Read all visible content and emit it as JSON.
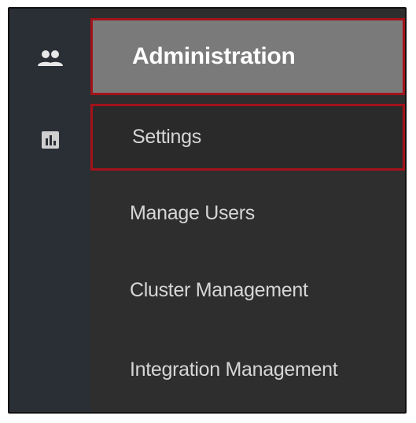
{
  "sidebar": {
    "rail_icons": [
      "people-icon",
      "bar-chart-icon"
    ],
    "menu": [
      {
        "label": "Administration",
        "selected": true
      },
      {
        "label": "Settings",
        "highlighted": true
      },
      {
        "label": "Manage Users"
      },
      {
        "label": "Cluster Management"
      },
      {
        "label": "Integration Management"
      }
    ]
  },
  "colors": {
    "rail_background": "#2a2e35",
    "menu_background": "#2e2e2f",
    "selected_background": "#7a7a7a",
    "highlight_border": "#a3121a",
    "menu_text": "#d6d6d6"
  }
}
